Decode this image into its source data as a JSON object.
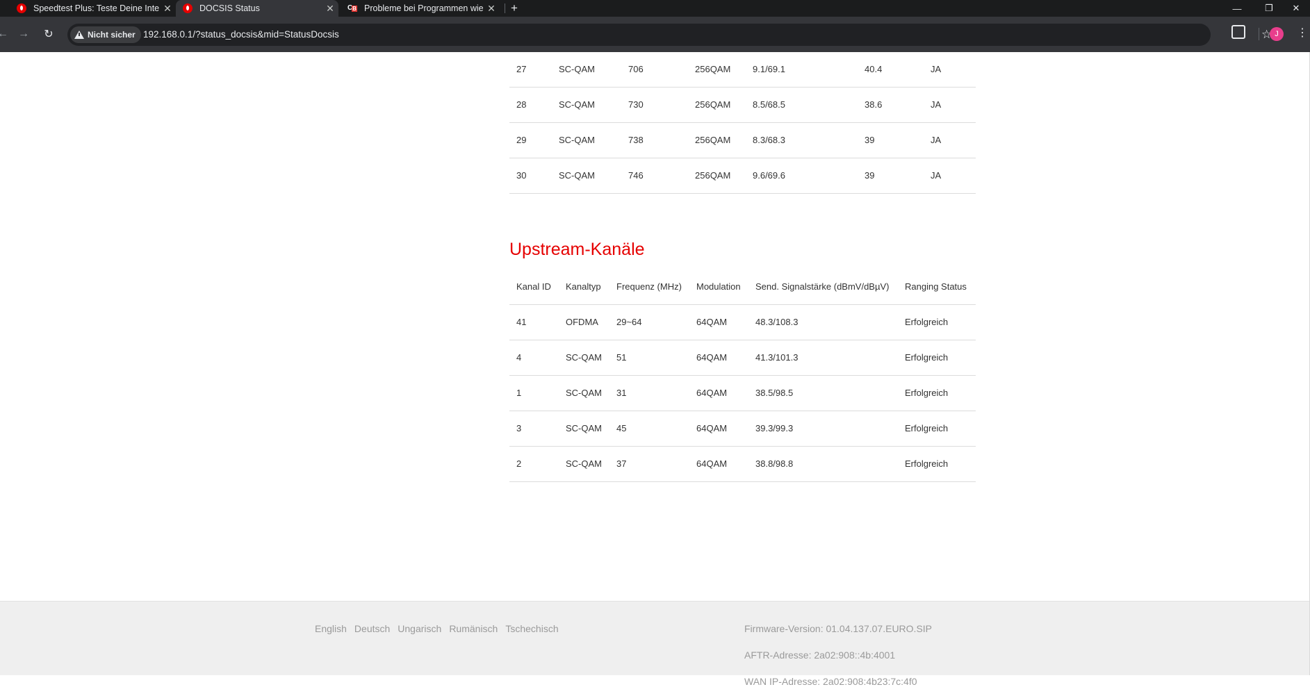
{
  "browser": {
    "tabs": [
      {
        "label": "Speedtest Plus: Teste Deine Inte",
        "icon": "vodafone-icon"
      },
      {
        "label": "DOCSIS Status",
        "icon": "vodafone-icon"
      },
      {
        "label": "Probleme bei Programmen wie",
        "icon": "computerbase-icon"
      }
    ],
    "security_label": "Nicht sicher",
    "url": "192.168.0.1/?status_docsis&mid=StatusDocsis",
    "avatar_initial": "J"
  },
  "downstream": {
    "rows": [
      [
        "27",
        "SC-QAM",
        "706",
        "256QAM",
        "9.1/69.1",
        "40.4",
        "JA"
      ],
      [
        "28",
        "SC-QAM",
        "730",
        "256QAM",
        "8.5/68.5",
        "38.6",
        "JA"
      ],
      [
        "29",
        "SC-QAM",
        "738",
        "256QAM",
        "8.3/68.3",
        "39",
        "JA"
      ],
      [
        "30",
        "SC-QAM",
        "746",
        "256QAM",
        "9.6/69.6",
        "39",
        "JA"
      ]
    ]
  },
  "upstream": {
    "title": "Upstream-Kanäle",
    "headers": [
      "Kanal ID",
      "Kanaltyp",
      "Frequenz (MHz)",
      "Modulation",
      "Send. Signalstärke (dBmV/dBµV)",
      "Ranging Status"
    ],
    "rows": [
      [
        "41",
        "OFDMA",
        "29~64",
        "64QAM",
        "48.3/108.3",
        "Erfolgreich"
      ],
      [
        "4",
        "SC-QAM",
        "51",
        "64QAM",
        "41.3/101.3",
        "Erfolgreich"
      ],
      [
        "1",
        "SC-QAM",
        "31",
        "64QAM",
        "38.5/98.5",
        "Erfolgreich"
      ],
      [
        "3",
        "SC-QAM",
        "45",
        "64QAM",
        "39.3/99.3",
        "Erfolgreich"
      ],
      [
        "2",
        "SC-QAM",
        "37",
        "64QAM",
        "38.8/98.8",
        "Erfolgreich"
      ]
    ]
  },
  "footer": {
    "languages": [
      "English",
      "Deutsch",
      "Ungarisch",
      "Rumänisch",
      "Tschechisch"
    ],
    "firmware": "Firmware-Version: 01.04.137.07.EURO.SIP",
    "aftr": "AFTR-Adresse: 2a02:908::4b:4001",
    "wan": "WAN IP-Adresse: 2a02:908:4b23:7c:4f0"
  },
  "colors": {
    "accent": "#e60000",
    "chrome_dark": "#202124",
    "footer_bg": "#efefef"
  }
}
